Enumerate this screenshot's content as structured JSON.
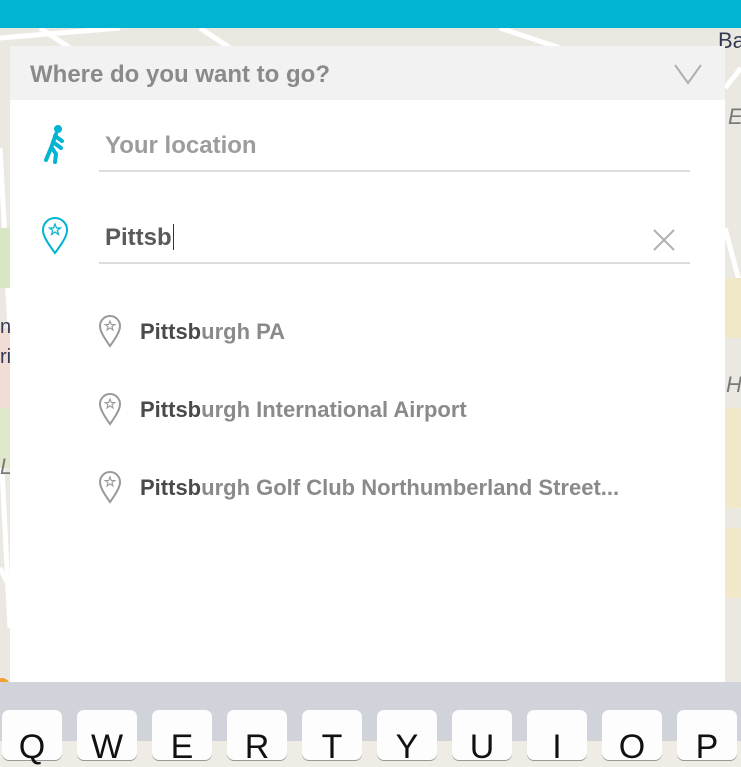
{
  "header": {
    "title": "Where do you want to go?",
    "collapse_icon": "chevron-down-icon"
  },
  "origin": {
    "placeholder": "Your location",
    "icon": "walking-person-icon"
  },
  "destination": {
    "value": "Pittsb",
    "icon": "location-pin-icon",
    "clear_icon": "close-icon"
  },
  "suggestions": [
    {
      "match": "Pittsb",
      "rest": "urgh PA"
    },
    {
      "match": "Pittsb",
      "rest": "urgh International Airport"
    },
    {
      "match": "Pittsb",
      "rest": "urgh Golf Club Northumberland Street..."
    }
  ],
  "map": {
    "labels": [
      "Ba",
      "E",
      "ni",
      "ri",
      "H",
      "L"
    ]
  },
  "keyboard": {
    "keys": [
      "Q",
      "W",
      "E",
      "R",
      "T",
      "Y",
      "U",
      "I",
      "O",
      "P"
    ]
  },
  "colors": {
    "accent": "#00b4d2",
    "panel_header": "#f2f2f2"
  }
}
